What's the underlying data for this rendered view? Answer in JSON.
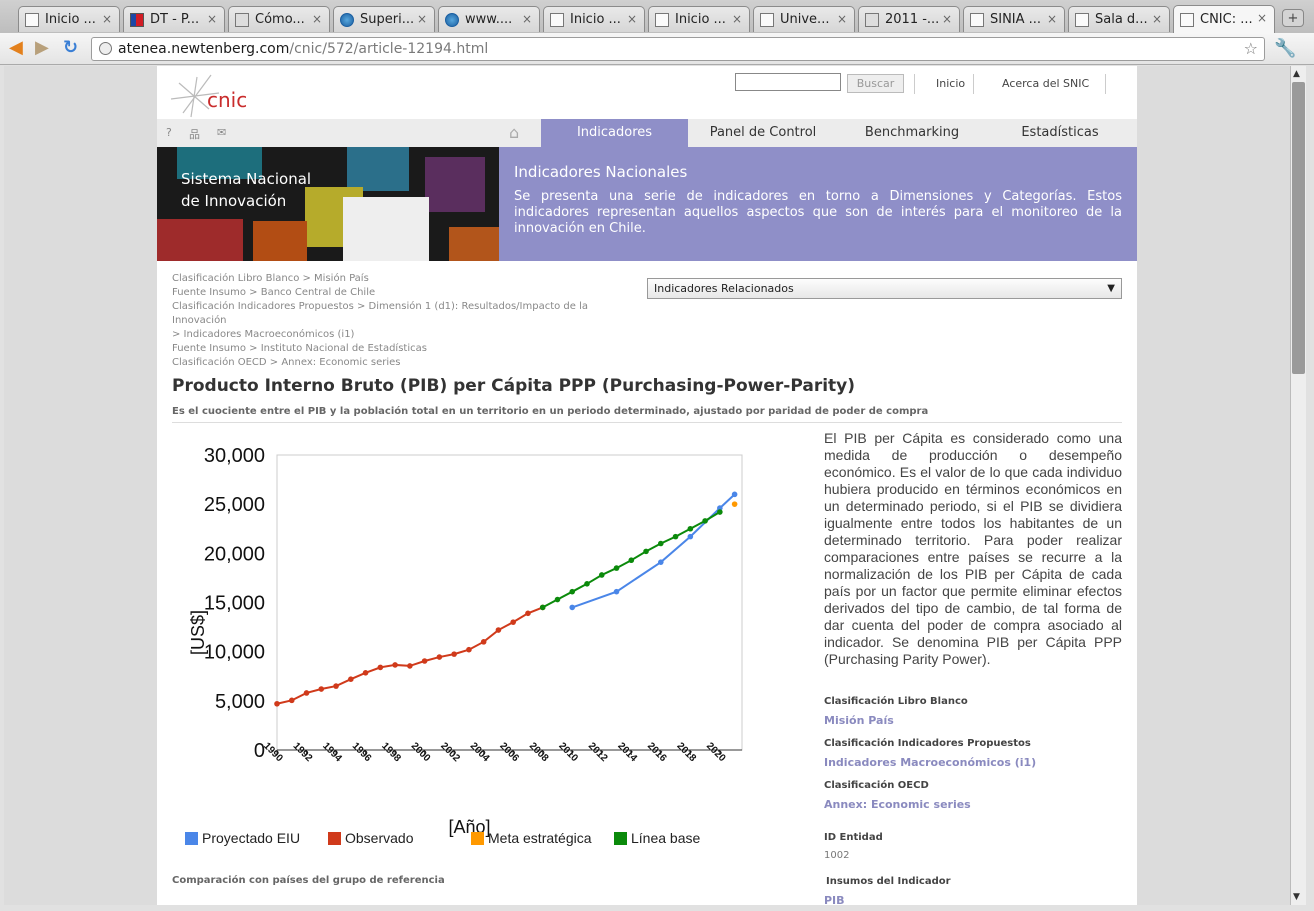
{
  "tabs": [
    {
      "label": "Inicio ...",
      "icon": "doc"
    },
    {
      "label": "DT - P...",
      "icon": "flag"
    },
    {
      "label": "Cómo...",
      "icon": "img"
    },
    {
      "label": "Superi...",
      "icon": "globe"
    },
    {
      "label": "www....",
      "icon": "globe"
    },
    {
      "label": "Inicio ...",
      "icon": "doc"
    },
    {
      "label": "Inicio ...",
      "icon": "doc"
    },
    {
      "label": "Unive...",
      "icon": "doc"
    },
    {
      "label": "2011 -...",
      "icon": "img"
    },
    {
      "label": "SINIA ...",
      "icon": "doc"
    },
    {
      "label": "Sala d...",
      "icon": "doc"
    },
    {
      "label": "CNIC: ...",
      "icon": "doc"
    }
  ],
  "address": {
    "host": "atenea.newtenberg.com",
    "path": "/cnic/572/article-12194.html"
  },
  "header": {
    "logo_text": "cnic",
    "search_button": "Buscar",
    "links": [
      "Inicio",
      "Acerca del SNIC"
    ],
    "tools": [
      "?",
      "品",
      "✉"
    ]
  },
  "nav": {
    "tabs": [
      "Indicadores",
      "Panel de Control",
      "Benchmarking",
      "Estadísticas"
    ],
    "active": 0
  },
  "banner": {
    "title_line1": "Sistema Nacional",
    "title_line2": "de Innovación",
    "heading": "Indicadores Nacionales",
    "text": "Se presenta una serie de indicadores en torno a Dimensiones y Categorías. Estos indicadores representan aquellos aspectos que son de interés para el monitoreo de la innovación en Chile."
  },
  "breadcrumbs": [
    "Clasificación Libro Blanco > Misión País",
    "Fuente Insumo > Banco Central de Chile",
    "Clasificación Indicadores Propuestos > Dimensión 1 (d1): Resultados/Impacto de la Innovación",
    "> Indicadores Macroeconómicos (i1)",
    "Fuente Insumo > Instituto Nacional de Estadísticas",
    "Clasificación OECD > Annex: Economic series"
  ],
  "related_select": "Indicadores Relacionados",
  "article": {
    "title": "Producto Interno Bruto (PIB) per Cápita PPP (Purchasing-Power-Parity)",
    "subtitle": "Es el cuociente entre el PIB y la población total en un territorio en un periodo determinado, ajustado por paridad de poder de compra",
    "description": "El PIB per Cápita es considerado como una medida de producción o desempeño económico. Es el valor de lo que cada individuo hubiera producido en términos económicos en un determinado periodo, si el PIB se dividiera igualmente entre todos los habitantes de un determinado territorio. Para poder realizar comparaciones entre países se recurre a la normalización de los PIB per Cápita de cada país por un factor que permite eliminar efectos derivados del tipo de cambio, de tal forma de dar cuenta del poder de compra asociado al indicador. Se denomina PIB per Cápita PPP (Purchasing Parity Power).",
    "compare_heading": "Comparación con países del grupo de referencia"
  },
  "meta": [
    {
      "label": "Clasificación Libro Blanco",
      "value": "Misión País"
    },
    {
      "label": "Clasificación Indicadores Propuestos",
      "value": "Indicadores Macroeconómicos (i1)"
    },
    {
      "label": "Clasificación OECD",
      "value": "Annex: Economic series"
    },
    {
      "label": "ID Entidad",
      "value": "1002"
    },
    {
      "label": "Insumos del Indicador",
      "value": "PIB"
    }
  ],
  "chart_data": {
    "type": "line",
    "xlabel": "[Año]",
    "ylabel": "[US$]",
    "ylim": [
      0,
      30000
    ],
    "yticks": [
      "0",
      "5,000",
      "10,000",
      "15,000",
      "20,000",
      "25,000",
      "30,000"
    ],
    "xticks": [
      "1990",
      "1992",
      "1994",
      "1996",
      "1998",
      "2000",
      "2002",
      "2004",
      "2006",
      "2008",
      "2010",
      "2012",
      "2014",
      "2016",
      "2018",
      "2020"
    ],
    "grid": false,
    "legend_position": "bottom",
    "series": [
      {
        "name": "Proyectado EIU",
        "color": "#4a86e8",
        "x": [
          2010,
          2013,
          2016,
          2018,
          2020,
          2021
        ],
        "y": [
          14500,
          16100,
          19100,
          21700,
          24600,
          26000
        ]
      },
      {
        "name": "Observado",
        "color": "#d03a1b",
        "x": [
          1990,
          1991,
          1992,
          1993,
          1994,
          1995,
          1996,
          1997,
          1998,
          1999,
          2000,
          2001,
          2002,
          2003,
          2004,
          2005,
          2006,
          2007,
          2008
        ],
        "y": [
          4700,
          5050,
          5800,
          6200,
          6500,
          7200,
          7850,
          8400,
          8650,
          8550,
          9050,
          9450,
          9750,
          10200,
          11000,
          12200,
          13000,
          13900,
          14500
        ]
      },
      {
        "name": "Meta estratégica",
        "color": "#ff9900",
        "x": [
          2021
        ],
        "y": [
          25000
        ]
      },
      {
        "name": "Línea base",
        "color": "#0b8a0b",
        "x": [
          2008,
          2009,
          2010,
          2011,
          2012,
          2013,
          2014,
          2015,
          2016,
          2017,
          2018,
          2019,
          2020
        ],
        "y": [
          14500,
          15300,
          16100,
          16900,
          17800,
          18500,
          19300,
          20200,
          21000,
          21700,
          22500,
          23300,
          24200
        ]
      }
    ]
  }
}
